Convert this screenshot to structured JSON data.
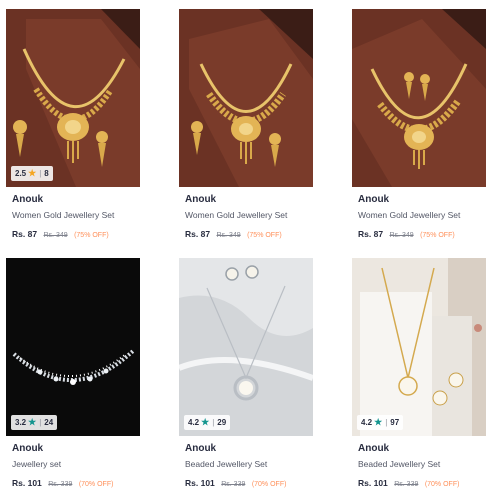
{
  "products": [
    {
      "brand": "Anouk",
      "name": "Women Gold Jewellery Set",
      "price": "Rs. 87",
      "mrp": "Rs. 349",
      "discount": "(75% OFF)",
      "rating": "2.5",
      "rating_count": "8",
      "star_color": "#f5a623",
      "image": "gold-necklace-set-on-wood"
    },
    {
      "brand": "Anouk",
      "name": "Women Gold Jewellery Set",
      "price": "Rs. 87",
      "mrp": "Rs. 349",
      "discount": "(75% OFF)",
      "rating": "",
      "rating_count": "",
      "star_color": "#14958f",
      "image": "gold-necklace-set-on-wood"
    },
    {
      "brand": "Anouk",
      "name": "Women Gold Jewellery Set",
      "price": "Rs. 87",
      "mrp": "Rs. 349",
      "discount": "(75% OFF)",
      "rating": "",
      "rating_count": "",
      "star_color": "#14958f",
      "image": "gold-necklace-set-on-wood"
    },
    {
      "brand": "Anouk",
      "name": "Jewellery set",
      "price": "Rs. 101",
      "mrp": "Rs. 339",
      "discount": "(70% OFF)",
      "rating": "3.2",
      "rating_count": "24",
      "star_color": "#14958f",
      "image": "silver-crystal-necklace-on-black"
    },
    {
      "brand": "Anouk",
      "name": "Beaded Jewellery Set",
      "price": "Rs. 101",
      "mrp": "Rs. 339",
      "discount": "(70% OFF)",
      "rating": "4.2",
      "rating_count": "29",
      "star_color": "#14958f",
      "image": "silver-pearl-pendant-set"
    },
    {
      "brand": "Anouk",
      "name": "Beaded Jewellery Set",
      "price": "Rs. 101",
      "mrp": "Rs. 339",
      "discount": "(70% OFF)",
      "rating": "4.2",
      "rating_count": "97",
      "star_color": "#14958f",
      "image": "gold-pearl-pendant-set"
    }
  ],
  "icons": {
    "rating_star": "star-icon"
  }
}
